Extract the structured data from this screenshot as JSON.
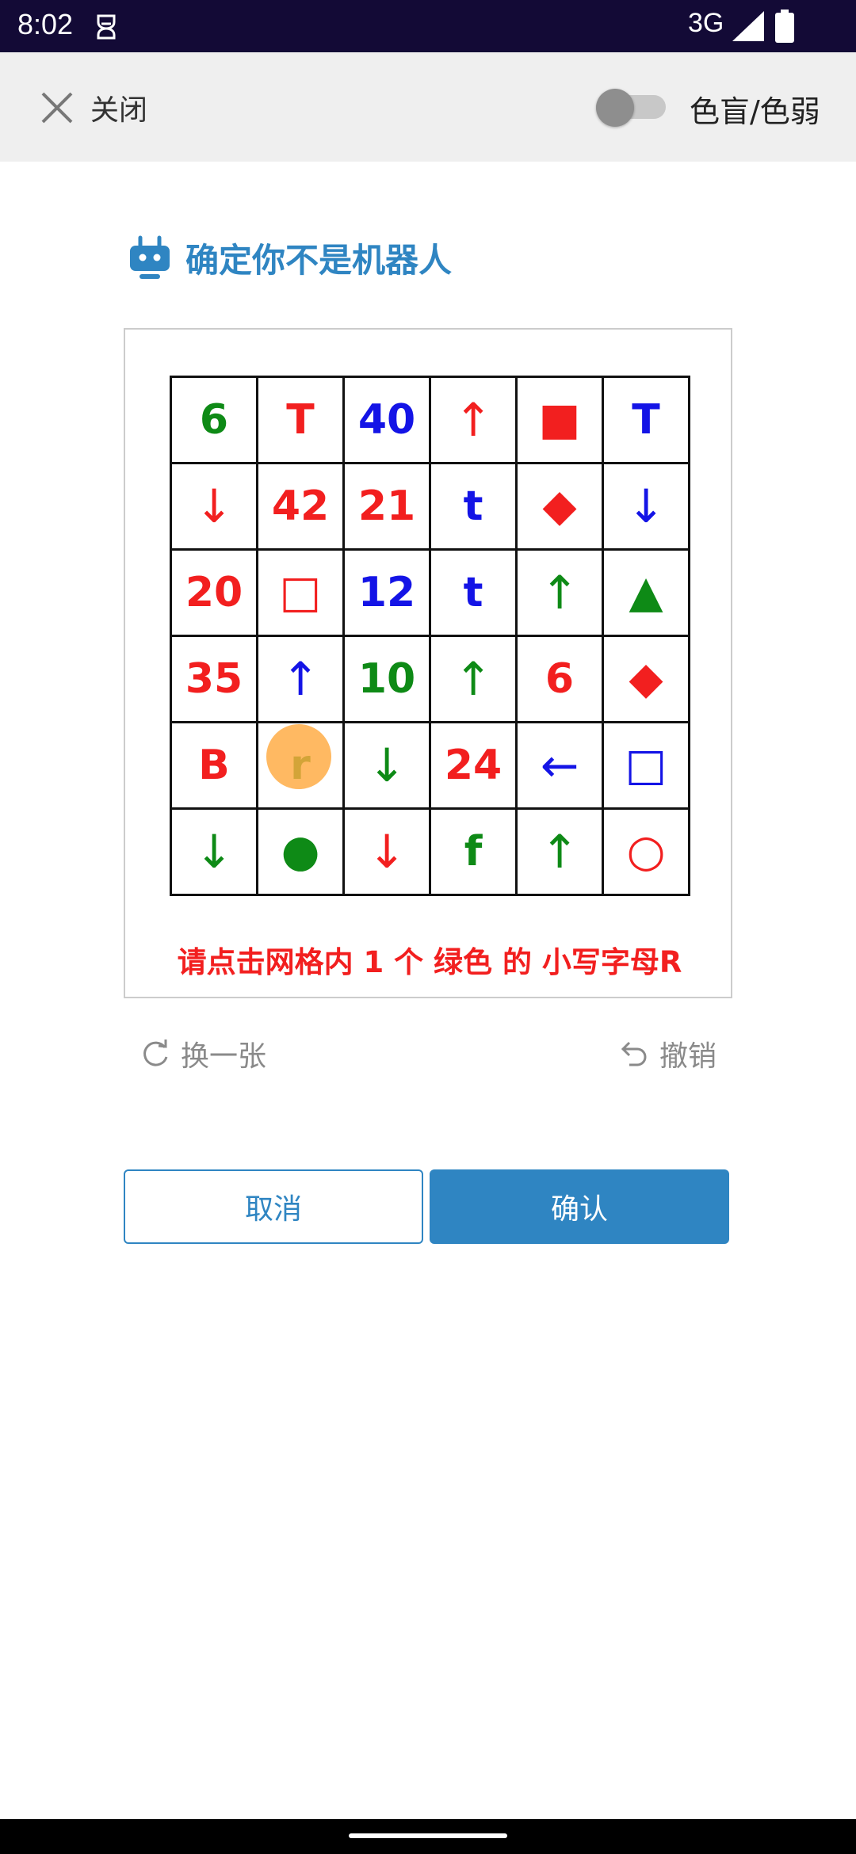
{
  "status_bar": {
    "time": "8:02",
    "network": "3G",
    "icons": [
      "notification-icon",
      "signal-icon",
      "battery-icon"
    ]
  },
  "top_bar": {
    "close_label": "关闭",
    "colorblind_label": "色盲/色弱",
    "colorblind_enabled": false
  },
  "title": "确定你不是机器人",
  "captcha": {
    "grid": [
      [
        {
          "t": "6",
          "c": "#0e8a16"
        },
        {
          "t": "T",
          "c": "#f21f1f"
        },
        {
          "t": "40",
          "c": "#1414e6"
        },
        {
          "t": "↑",
          "c": "#f21f1f",
          "k": "arrow"
        },
        {
          "t": "■",
          "c": "#f21f1f",
          "k": "shape"
        },
        {
          "t": "T",
          "c": "#1414e6"
        }
      ],
      [
        {
          "t": "↓",
          "c": "#f21f1f",
          "k": "arrow"
        },
        {
          "t": "42",
          "c": "#f21f1f"
        },
        {
          "t": "21",
          "c": "#f21f1f"
        },
        {
          "t": "t",
          "c": "#1414e6"
        },
        {
          "t": "◆",
          "c": "#f21f1f",
          "k": "shape"
        },
        {
          "t": "↓",
          "c": "#1414e6",
          "k": "arrow"
        }
      ],
      [
        {
          "t": "20",
          "c": "#f21f1f"
        },
        {
          "t": "□",
          "c": "#f21f1f",
          "k": "shape"
        },
        {
          "t": "12",
          "c": "#1414e6"
        },
        {
          "t": "t",
          "c": "#1414e6"
        },
        {
          "t": "↑",
          "c": "#0e8a16",
          "k": "arrow"
        },
        {
          "t": "▲",
          "c": "#0e8a16",
          "k": "shape"
        }
      ],
      [
        {
          "t": "35",
          "c": "#f21f1f"
        },
        {
          "t": "↑",
          "c": "#1414e6",
          "k": "arrow"
        },
        {
          "t": "10",
          "c": "#0e8a16"
        },
        {
          "t": "↑",
          "c": "#0e8a16",
          "k": "arrow"
        },
        {
          "t": "6",
          "c": "#f21f1f"
        },
        {
          "t": "◆",
          "c": "#f21f1f",
          "k": "shape"
        }
      ],
      [
        {
          "t": "B",
          "c": "#f21f1f"
        },
        {
          "t": "r",
          "c": "#0e8a16"
        },
        {
          "t": "↓",
          "c": "#0e8a16",
          "k": "arrow"
        },
        {
          "t": "24",
          "c": "#f21f1f"
        },
        {
          "t": "←",
          "c": "#1414e6",
          "k": "arrow"
        },
        {
          "t": "□",
          "c": "#1414e6",
          "k": "shape"
        }
      ],
      [
        {
          "t": "↓",
          "c": "#0e8a16",
          "k": "arrow"
        },
        {
          "t": "●",
          "c": "#0e8a16",
          "k": "shape"
        },
        {
          "t": "↓",
          "c": "#f21f1f",
          "k": "arrow"
        },
        {
          "t": "f",
          "c": "#0e8a16"
        },
        {
          "t": "↑",
          "c": "#0e8a16",
          "k": "arrow"
        },
        {
          "t": "○",
          "c": "#f21f1f",
          "k": "shape"
        }
      ]
    ],
    "instruction": "请点击网格内 1 个 绿色 的 小写字母R",
    "refresh_label": "换一张",
    "undo_label": "撤销"
  },
  "buttons": {
    "cancel": "取消",
    "confirm": "确认"
  },
  "colors": {
    "accent": "#2f85c2",
    "red": "#f21f1f",
    "green": "#0e8a16",
    "blue": "#1414e6",
    "tap_marker": "#ffa940",
    "status_bar": "#130a36"
  }
}
